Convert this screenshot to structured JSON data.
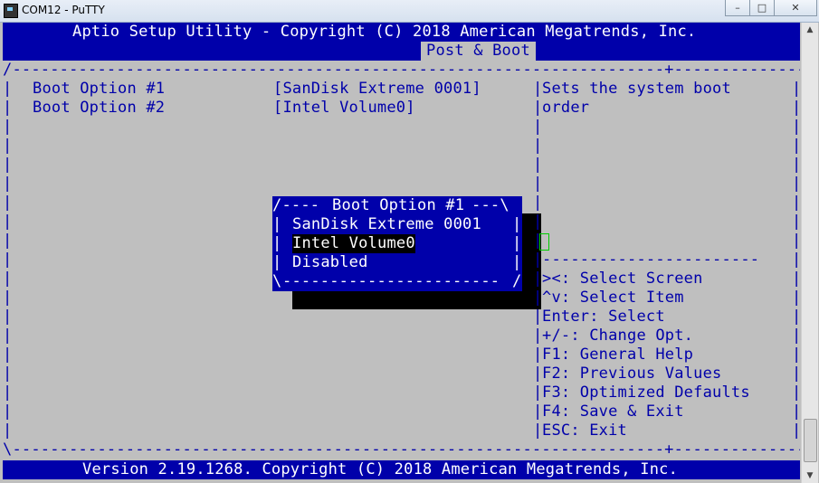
{
  "window": {
    "title": "COM12 - PuTTY",
    "minimize_glyph": "–",
    "maximize_glyph": "□",
    "close_glyph": "✕"
  },
  "bios": {
    "header_title": "Aptio Setup Utility - Copyright (C) 2018 American Megatrends, Inc.",
    "active_tab": "Post & Boot",
    "border_top": "/---------------------------------------------------------------------+------------------------\\",
    "options": [
      {
        "label": "Boot Option #1",
        "value": "[SanDisk Extreme 0001]"
      },
      {
        "label": "Boot Option #2",
        "value": "[Intel Volume0]"
      }
    ],
    "help_text": [
      "Sets the system boot",
      "order"
    ],
    "keys_divider": "-----------------------",
    "keys": [
      "><: Select Screen",
      "^v: Select Item",
      "Enter: Select",
      "+/-: Change Opt.",
      "F1: General Help",
      "F2: Previous Values",
      "F3: Optimized Defaults",
      "F4: Save & Exit",
      "ESC: Exit"
    ],
    "border_bottom": "\\---------------------------------------------------------------------+------------------------/",
    "footer": "Version 2.19.1268. Copyright (C) 2018 American Megatrends, Inc."
  },
  "popup": {
    "title": "Boot Option #1",
    "choices": [
      "SanDisk Extreme 0001",
      "Intel Volume0",
      "Disabled"
    ],
    "selected_index": 1,
    "bottom_border": "-----------------------"
  },
  "scrollbar": {
    "up_glyph": "▲",
    "down_glyph": "▼"
  }
}
